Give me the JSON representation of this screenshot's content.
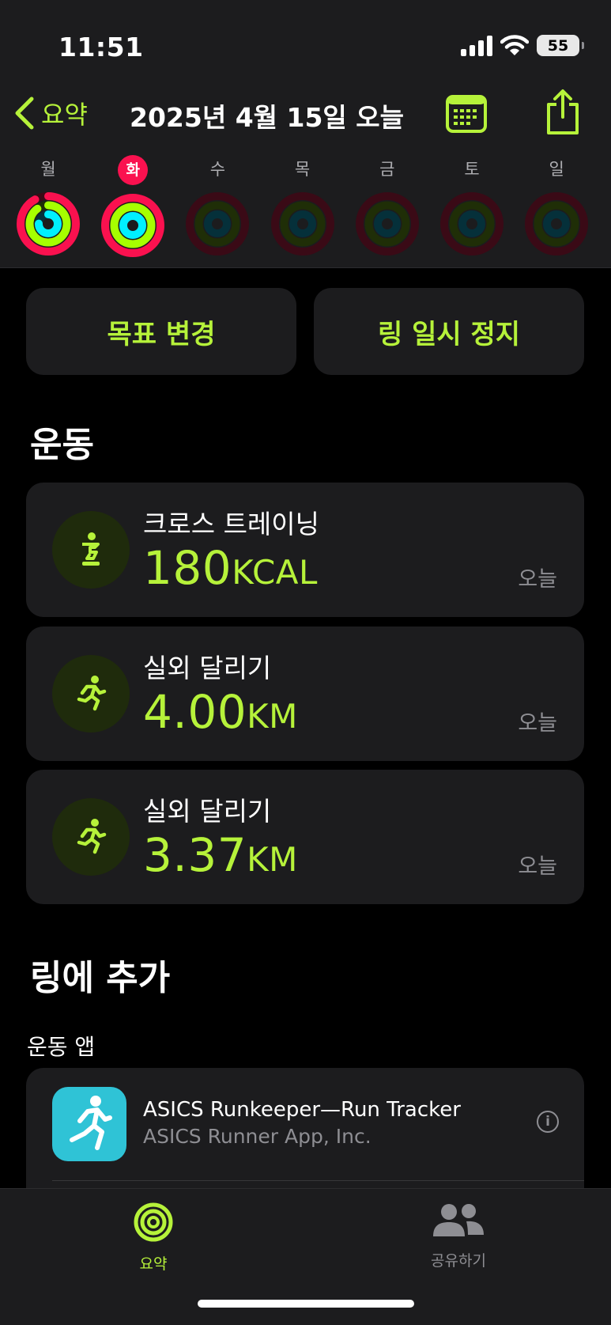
{
  "status": {
    "time": "11:51",
    "battery": "55"
  },
  "nav": {
    "back_label": "요약",
    "title": "2025년 4월 15일 오늘"
  },
  "week": [
    {
      "label": "월",
      "selected": false,
      "move": 0.92,
      "exercise": 0.9,
      "stand": 0.75
    },
    {
      "label": "화",
      "selected": true,
      "move": 1.0,
      "exercise": 1.0,
      "stand": 1.0
    },
    {
      "label": "수",
      "selected": false,
      "move": 0,
      "exercise": 0,
      "stand": 0
    },
    {
      "label": "목",
      "selected": false,
      "move": 0,
      "exercise": 0,
      "stand": 0
    },
    {
      "label": "금",
      "selected": false,
      "move": 0,
      "exercise": 0,
      "stand": 0
    },
    {
      "label": "토",
      "selected": false,
      "move": 0,
      "exercise": 0,
      "stand": 0
    },
    {
      "label": "일",
      "selected": false,
      "move": 0,
      "exercise": 0,
      "stand": 0
    }
  ],
  "actions": {
    "change_goal": "목표 변경",
    "pause_rings": "링 일시 정지"
  },
  "workouts_title": "운동",
  "workouts": [
    {
      "icon": "cross-training-icon",
      "name": "크로스 트레이닝",
      "value": "180",
      "unit": "KCAL",
      "date": "오늘"
    },
    {
      "icon": "running-icon",
      "name": "실외 달리기",
      "value": "4.00",
      "unit": "KM",
      "date": "오늘"
    },
    {
      "icon": "running-icon",
      "name": "실외 달리기",
      "value": "3.37",
      "unit": "KM",
      "date": "오늘"
    }
  ],
  "add_to_rings": {
    "title": "링에 추가",
    "section": "운동 앱",
    "apps": [
      {
        "name": "ASICS Runkeeper—Run Tracker",
        "developer": "ASICS Runner App, Inc."
      }
    ]
  },
  "tabbar": {
    "summary": "요약",
    "sharing": "공유하기"
  },
  "colors": {
    "accent": "#b6f23a",
    "move": "#fa114f",
    "exercise": "#a6ff00",
    "stand": "#00f0ff"
  }
}
